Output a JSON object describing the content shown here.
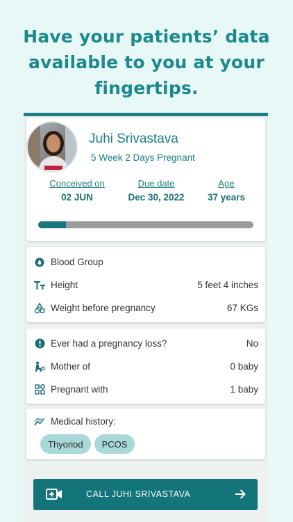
{
  "headline": {
    "line1": "Have your patients’ data",
    "line2": "available to you at your",
    "line3": "fingertips."
  },
  "patient": {
    "name": "Juhi Srivastava",
    "status": "5 Week 2 Days Pregnant",
    "stats": [
      {
        "label": "Conceived on",
        "value": "02 JUN"
      },
      {
        "label": "Due date",
        "value": "Dec 30, 2022"
      },
      {
        "label": "Age",
        "value": "37 years"
      }
    ],
    "progress_fraction": 0.13
  },
  "vitals": [
    {
      "icon": "blood-drop-icon",
      "label": "Blood Group",
      "value": ""
    },
    {
      "icon": "text-height-icon",
      "label": "Height",
      "value": "5 feet 4 inches"
    },
    {
      "icon": "weight-shapes-icon",
      "label": "Weight before pregnancy",
      "value": "67 KGs"
    }
  ],
  "pregnancy": [
    {
      "icon": "alert-icon",
      "label": "Ever had a pregnancy loss?",
      "value": "No"
    },
    {
      "icon": "mother-child-icon",
      "label": "Mother of",
      "value": "0 baby"
    },
    {
      "icon": "grid-icon",
      "label": "Pregnant with",
      "value": "1 baby"
    }
  ],
  "medical": {
    "label": "Medical history:",
    "chips": [
      "Thyoriod",
      "PCOS"
    ]
  },
  "call_button": {
    "label": "CALL JUHI SRIVASTAVA"
  },
  "colors": {
    "accent": "#1b7f84",
    "button": "#137479",
    "background": "#e8f8f7",
    "chip": "#a8d8d8",
    "progress_track": "#9b9b9b"
  }
}
